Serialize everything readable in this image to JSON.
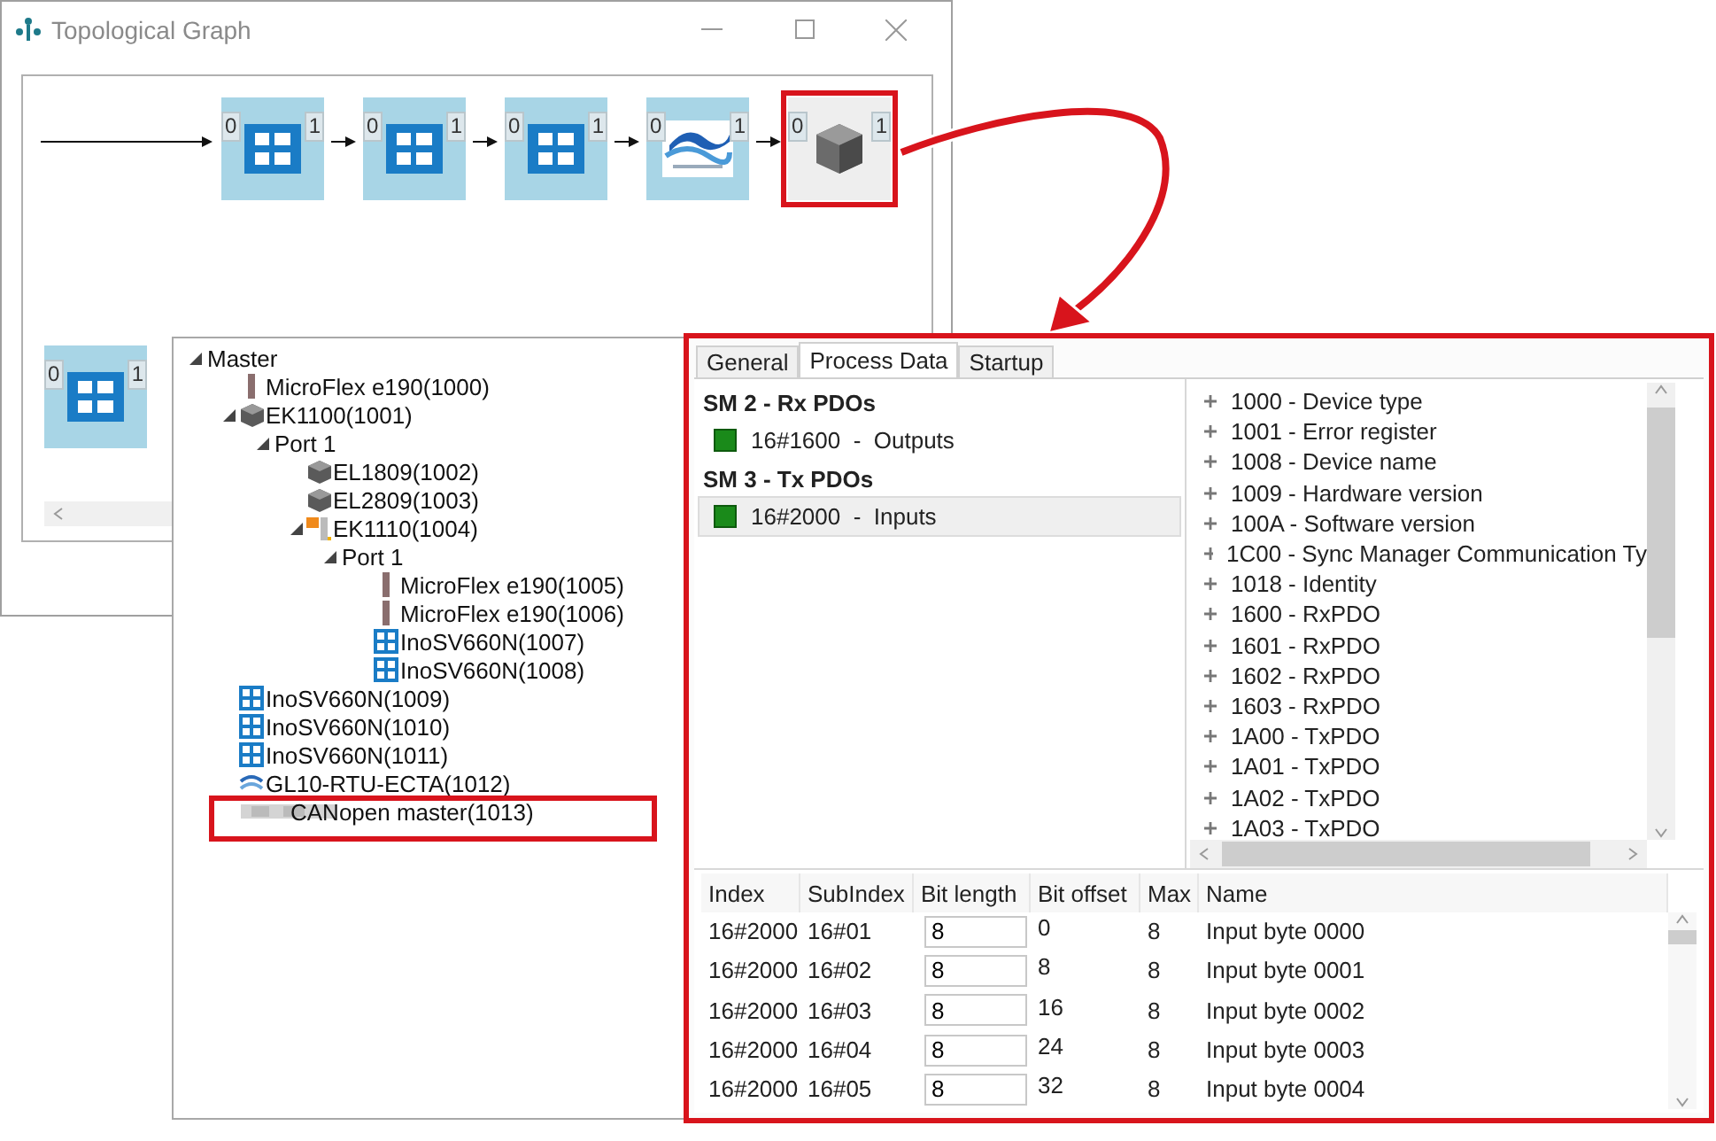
{
  "graph_window": {
    "title": "Topological Graph",
    "nodes": [
      {
        "kind": "ino",
        "port_in": "0",
        "port_out": "1",
        "selected": false
      },
      {
        "kind": "ino",
        "port_in": "0",
        "port_out": "1",
        "selected": false
      },
      {
        "kind": "ino",
        "port_in": "0",
        "port_out": "1",
        "selected": false
      },
      {
        "kind": "wave",
        "port_in": "0",
        "port_out": "1",
        "selected": false
      },
      {
        "kind": "unknown",
        "port_in": "0",
        "port_out": "1",
        "selected": true
      }
    ],
    "second_row": [
      {
        "kind": "ino",
        "port_in": "0",
        "port_out": "1",
        "selected": false
      }
    ]
  },
  "tree": {
    "items": [
      {
        "label": "Master",
        "expanded": true,
        "highlighted": false,
        "children": [
          {
            "label": "MicroFlex e190(1000)",
            "kind": "servo",
            "highlighted": false
          },
          {
            "label": "EK1100(1001)",
            "kind": "module",
            "expanded": true,
            "highlighted": false,
            "children": [
              {
                "label": "Port 1",
                "expanded": true,
                "highlighted": false,
                "children": [
                  {
                    "label": "EL1809(1002)",
                    "kind": "module",
                    "highlighted": false
                  },
                  {
                    "label": "EL2809(1003)",
                    "kind": "module",
                    "highlighted": false
                  },
                  {
                    "label": "EK1110(1004)",
                    "kind": "coupler",
                    "expanded": true,
                    "highlighted": false,
                    "children": [
                      {
                        "label": "Port 1",
                        "expanded": true,
                        "highlighted": false,
                        "children": [
                          {
                            "label": "MicroFlex e190(1005)",
                            "kind": "servo",
                            "highlighted": false
                          },
                          {
                            "label": "MicroFlex e190(1006)",
                            "kind": "servo",
                            "highlighted": false
                          },
                          {
                            "label": "InoSV660N(1007)",
                            "kind": "ino",
                            "highlighted": false
                          },
                          {
                            "label": "InoSV660N(1008)",
                            "kind": "ino",
                            "highlighted": false
                          }
                        ]
                      }
                    ]
                  }
                ]
              }
            ]
          },
          {
            "label": "InoSV660N(1009)",
            "kind": "ino",
            "highlighted": false
          },
          {
            "label": "InoSV660N(1010)",
            "kind": "ino",
            "highlighted": false
          },
          {
            "label": "InoSV660N(1011)",
            "kind": "ino",
            "highlighted": false
          },
          {
            "label": "GL10-RTU-ECTA(1012)",
            "kind": "wave",
            "highlighted": false
          },
          {
            "label": "CANopen master(1013)",
            "kind": "blurred",
            "highlighted": true
          }
        ]
      }
    ]
  },
  "details": {
    "tabs": [
      {
        "label": "General",
        "selected": false
      },
      {
        "label": "Process Data",
        "selected": true
      },
      {
        "label": "Startup",
        "selected": false
      }
    ],
    "pdo_groups": [
      {
        "title": "SM 2 - Rx PDOs",
        "entries": [
          {
            "label": "16#1600  -  Outputs",
            "selected": false
          }
        ]
      },
      {
        "title": "SM 3 - Tx PDOs",
        "entries": [
          {
            "label": "16#2000  -  Inputs",
            "selected": true
          }
        ]
      }
    ],
    "objects": [
      "1000 - Device type",
      "1001 - Error register",
      "1008 - Device name",
      "1009 - Hardware version",
      "100A - Software version",
      "1C00 - Sync Manager Communication Ty",
      "1018 - Identity",
      "1600 - RxPDO",
      "1601 - RxPDO",
      "1602 - RxPDO",
      "1603 - RxPDO",
      "1A00 - TxPDO",
      "1A01 - TxPDO",
      "1A02 - TxPDO",
      "1A03 - TxPDO"
    ],
    "table": {
      "columns": [
        "Index",
        "SubIndex",
        "Bit length",
        "Bit offset",
        "Max",
        "Name"
      ],
      "rows": [
        [
          "16#2000",
          "16#01",
          "8",
          "0",
          "8",
          "Input byte 0000"
        ],
        [
          "16#2000",
          "16#02",
          "8",
          "8",
          "8",
          "Input byte 0001"
        ],
        [
          "16#2000",
          "16#03",
          "8",
          "16",
          "8",
          "Input byte 0002"
        ],
        [
          "16#2000",
          "16#04",
          "8",
          "24",
          "8",
          "Input byte 0003"
        ],
        [
          "16#2000",
          "16#05",
          "8",
          "32",
          "8",
          "Input byte 0004"
        ]
      ]
    }
  }
}
